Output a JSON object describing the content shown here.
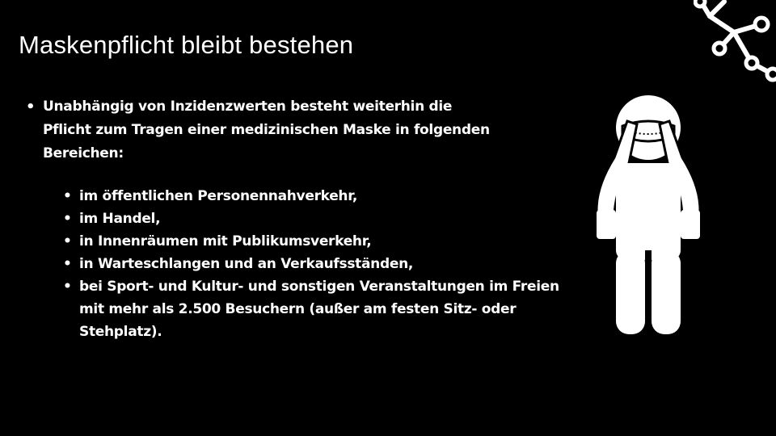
{
  "slide": {
    "title": "Maskenpflicht bleibt bestehen",
    "main_point": {
      "bullet": "•",
      "text": "Unabhängig von Inzidenzwerten besteht weiterhin die Pflicht zum Tragen einer medizinischen Maske in folgenden Bereichen:"
    },
    "sub_points": [
      {
        "bullet": "•",
        "text": "im öffentlichen Personennahverkehr,"
      },
      {
        "bullet": "•",
        "text": "im Handel,"
      },
      {
        "bullet": "•",
        "text": "in Innenräumen mit Publikumsverkehr,"
      },
      {
        "bullet": "•",
        "text": "in Warteschlangen und an Verkaufsständen,"
      },
      {
        "bullet": "•",
        "text": "bei Sport- und Kultur- und sonstigen Veranstaltungen im Freien mit mehr als 2.500 Besuchern (außer am festen Sitz- oder Stehplatz)."
      }
    ]
  },
  "icons": {
    "figure": "person-with-mask-icon",
    "virus": "virus-icon"
  },
  "colors": {
    "background": "#000000",
    "foreground": "#ffffff"
  }
}
